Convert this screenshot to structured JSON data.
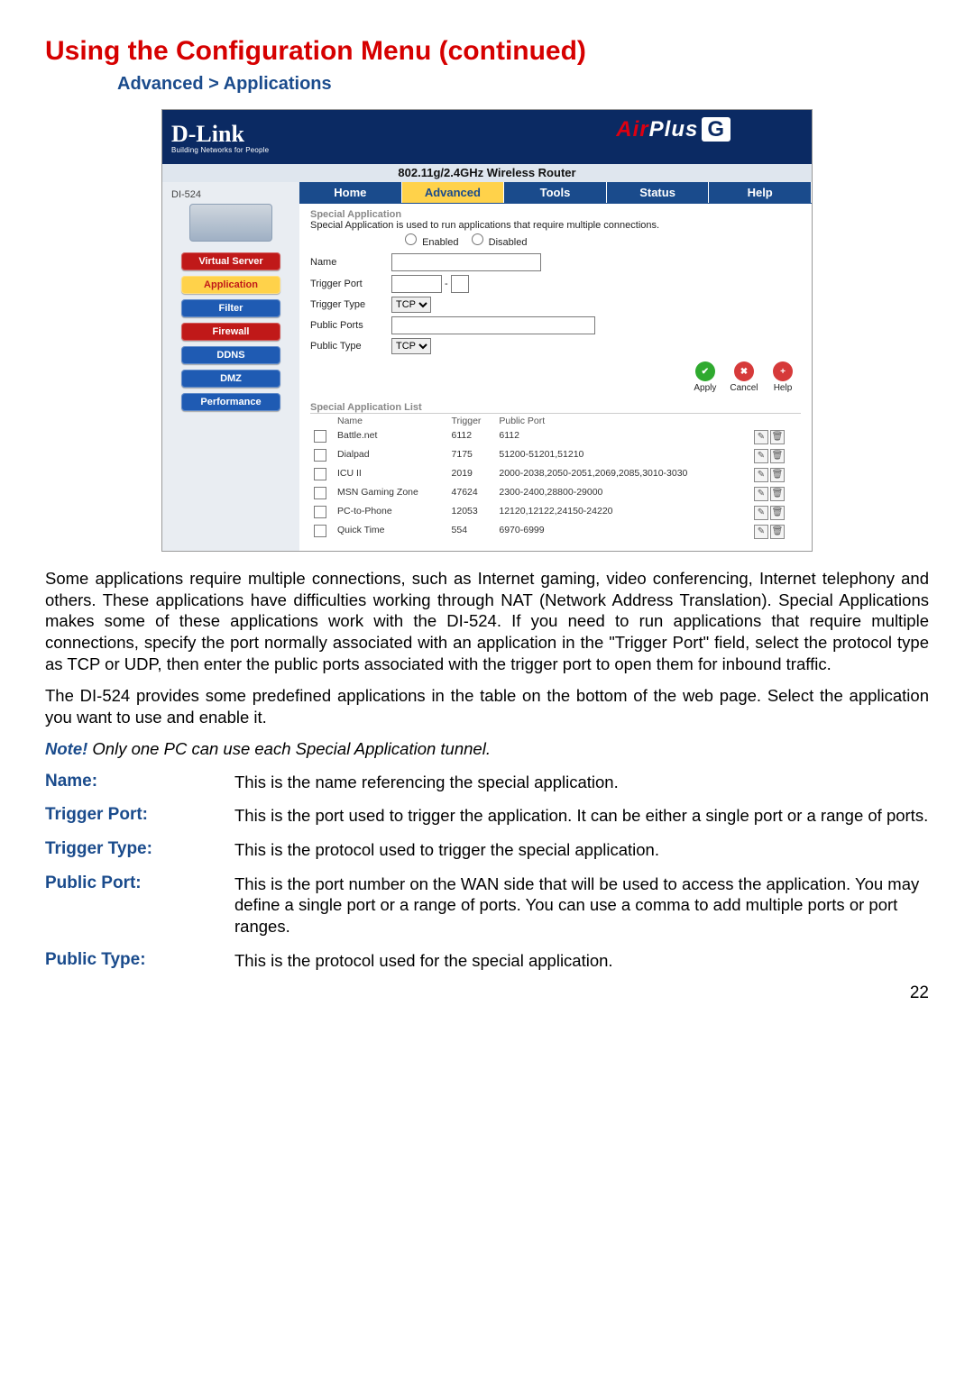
{
  "doc": {
    "title": "Using the Configuration Menu (continued)",
    "breadcrumb": "Advanced > Applications",
    "para1": "Some applications require multiple connections, such as Internet gaming, video conferencing, Internet telephony and others. These applications have difficulties working through NAT (Network Address Translation). Special Applications makes some of these applications work with the DI-524. If you need to run applications that require multiple connections, specify the port normally associated with an application in the \"Trigger Port\" field, select the protocol type as TCP or UDP, then enter the public ports associated with the trigger port to open them for inbound traffic.",
    "para2": "The DI-524 provides some predefined applications in the table on the bottom of the web page. Select the application you want to use and enable it.",
    "note_prefix": "Note!",
    "note_rest": " Only one PC can use each Special Application tunnel.",
    "defs": {
      "name": {
        "term": "Name:",
        "text": "This is the name referencing the special application."
      },
      "triggerPort": {
        "term": "Trigger Port:",
        "text": "This is the port used to trigger the application. It can be either a single port or a range of ports."
      },
      "triggerType": {
        "term": "Trigger Type:",
        "text": "This is the protocol used to trigger the special application."
      },
      "publicPort": {
        "term": "Public Port:",
        "text": "This is the port number on the WAN side that will be used to access the application. You may define a single port or a range of ports. You can use a comma to add multiple ports or port ranges."
      },
      "publicType": {
        "term": "Public Type:",
        "text": "This is the protocol used for the special application."
      }
    },
    "page_number": "22"
  },
  "router": {
    "brand": "D-Link",
    "brand_sub": "Building Networks for People",
    "product": "AirPlus",
    "product_suffix": "G",
    "subtitle": "802.11g/2.4GHz Wireless Router",
    "model": "DI-524",
    "side_items": [
      {
        "label": "Virtual Server",
        "style": "red"
      },
      {
        "label": "Application",
        "style": "active"
      },
      {
        "label": "Filter",
        "style": "blue"
      },
      {
        "label": "Firewall",
        "style": "red"
      },
      {
        "label": "DDNS",
        "style": "blue"
      },
      {
        "label": "DMZ",
        "style": "blue"
      },
      {
        "label": "Performance",
        "style": "blue"
      }
    ],
    "tabs": [
      {
        "label": "Home"
      },
      {
        "label": "Advanced",
        "active": true
      },
      {
        "label": "Tools"
      },
      {
        "label": "Status"
      },
      {
        "label": "Help"
      }
    ],
    "section_title": "Special Application",
    "section_desc": "Special Application is used to run applications that require multiple connections.",
    "radios": {
      "enabled": "Enabled",
      "disabled": "Disabled"
    },
    "form": {
      "name_label": "Name",
      "trigger_port_label": "Trigger Port",
      "trigger_type_label": "Trigger Type",
      "public_ports_label": "Public Ports",
      "public_type_label": "Public Type",
      "tcp_option": "TCP",
      "trigger_port_sep": "-"
    },
    "actions": {
      "apply": "Apply",
      "cancel": "Cancel",
      "help": "Help"
    },
    "list_title": "Special Application List",
    "list_headers": {
      "name": "Name",
      "trigger": "Trigger",
      "public": "Public Port"
    },
    "apps": [
      {
        "name": "Battle.net",
        "trigger": "6112",
        "public": "6112"
      },
      {
        "name": "Dialpad",
        "trigger": "7175",
        "public": "51200-51201,51210"
      },
      {
        "name": "ICU II",
        "trigger": "2019",
        "public": "2000-2038,2050-2051,2069,2085,3010-3030"
      },
      {
        "name": "MSN Gaming Zone",
        "trigger": "47624",
        "public": "2300-2400,28800-29000"
      },
      {
        "name": "PC-to-Phone",
        "trigger": "12053",
        "public": "12120,12122,24150-24220"
      },
      {
        "name": "Quick Time",
        "trigger": "554",
        "public": "6970-6999"
      }
    ]
  }
}
